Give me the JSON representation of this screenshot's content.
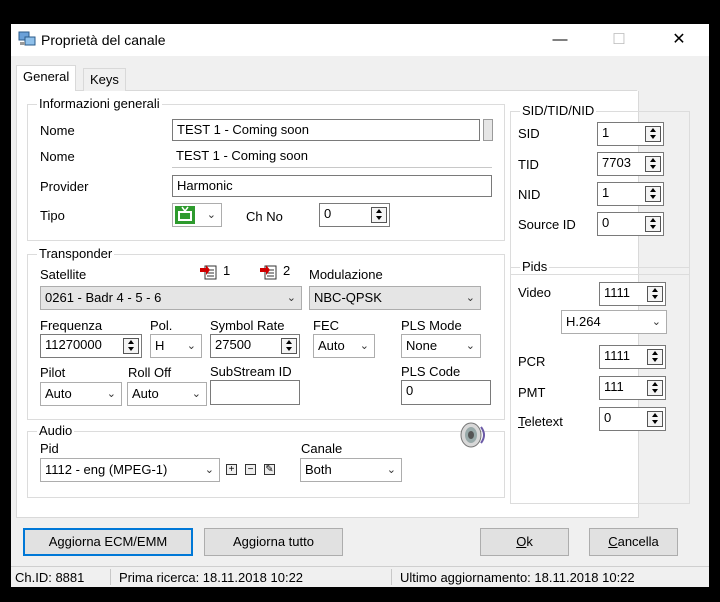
{
  "window": {
    "title": "Proprietà del canale",
    "minimize": "—",
    "maximize": "☐",
    "close": "✕"
  },
  "tabs": [
    {
      "label": "General"
    },
    {
      "label": "Keys"
    }
  ],
  "general_info": {
    "legend": "Informazioni generali",
    "name1_label": "Nome",
    "name1_value": "TEST 1 - Coming soon",
    "name2_label": "Nome",
    "name2_value": "TEST 1 - Coming soon",
    "provider_label": "Provider",
    "provider_value": "Harmonic",
    "type_label": "Tipo",
    "chno_label": "Ch No",
    "chno_value": "0"
  },
  "transponder": {
    "legend": "Transponder",
    "satellite_label": "Satellite",
    "sat_marker1": "1",
    "sat_marker2": "2",
    "satellite_value": "0261 - Badr 4 - 5 - 6",
    "modulation_label": "Modulazione",
    "modulation_value": "NBC-QPSK",
    "freq_label": "Frequenza",
    "freq_value": "11270000",
    "pol_label": "Pol.",
    "pol_value": "H",
    "sr_label": "Symbol Rate",
    "sr_value": "27500",
    "fec_label": "FEC",
    "fec_value": "Auto",
    "pls_mode_label": "PLS Mode",
    "pls_mode_value": "None",
    "pilot_label": "Pilot",
    "pilot_value": "Auto",
    "rolloff_label": "Roll Off",
    "rolloff_value": "Auto",
    "substream_label": "SubStream ID",
    "substream_value": "",
    "pls_code_label": "PLS Code",
    "pls_code_value": "0"
  },
  "audio": {
    "legend": "Audio",
    "pid_label": "Pid",
    "pid_value": "1112  -  eng  (MPEG-1)",
    "canale_label": "Canale",
    "canale_value": "Both"
  },
  "sidtid": {
    "legend": "SID/TID/NID",
    "sid_label": "SID",
    "sid_value": "1",
    "tid_label": "TID",
    "tid_value": "7703",
    "nid_label": "NID",
    "nid_value": "1",
    "source_label": "Source ID",
    "source_value": "0"
  },
  "pids": {
    "legend": "Pids",
    "video_label": "Video",
    "video_value": "1111",
    "codec_value": "H.264",
    "pcr_label": "PCR",
    "pcr_value": "1111",
    "pmt_label": "PMT",
    "pmt_value": "111",
    "teletext_label_first": "T",
    "teletext_label_rest": "eletext",
    "teletext_value": "0"
  },
  "buttons": {
    "update_ecm": "Aggiorna ECM/EMM",
    "update_all": "Aggiorna tutto",
    "ok_first": "O",
    "ok_rest": "k",
    "cancel_first": "C",
    "cancel_rest": "ancella"
  },
  "status": {
    "chid": "Ch.ID: 8881",
    "first_scan": "Prima ricerca: 18.11.2018 10:22",
    "last_update": "Ultimo aggiornamento: 18.11.2018 10:22"
  },
  "colors": {
    "accent": "#0078d7",
    "tv_icon": "#2e9b2e"
  }
}
